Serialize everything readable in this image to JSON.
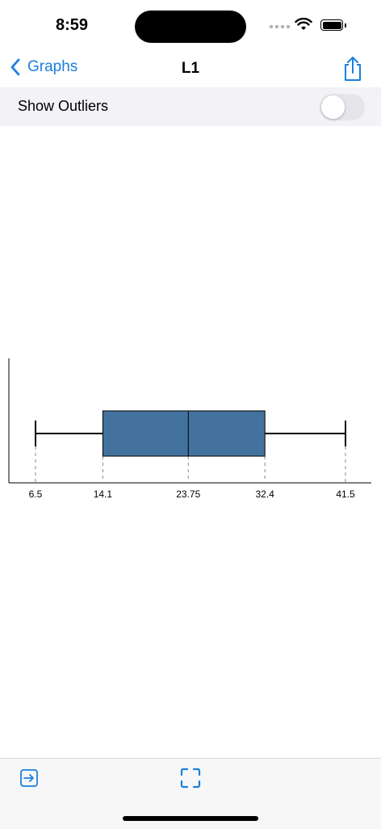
{
  "status_bar": {
    "time": "8:59"
  },
  "nav": {
    "back_label": "Graphs",
    "title": "L1",
    "share_icon": "share-icon"
  },
  "settings": {
    "show_outliers_label": "Show Outliers",
    "show_outliers_on": false
  },
  "chart_data": {
    "type": "boxplot",
    "orientation": "horizontal",
    "min": 6.5,
    "q1": 14.1,
    "median": 23.75,
    "q3": 32.4,
    "max": 41.5,
    "tick_labels": [
      "6.5",
      "14.1",
      "23.75",
      "32.4",
      "41.5"
    ],
    "box_color": "#44729e"
  },
  "toolbar": {
    "left_icon": "enter-arrow-icon",
    "center_icon": "fullscreen-icon"
  },
  "colors": {
    "accent": "#1a7fe0"
  }
}
